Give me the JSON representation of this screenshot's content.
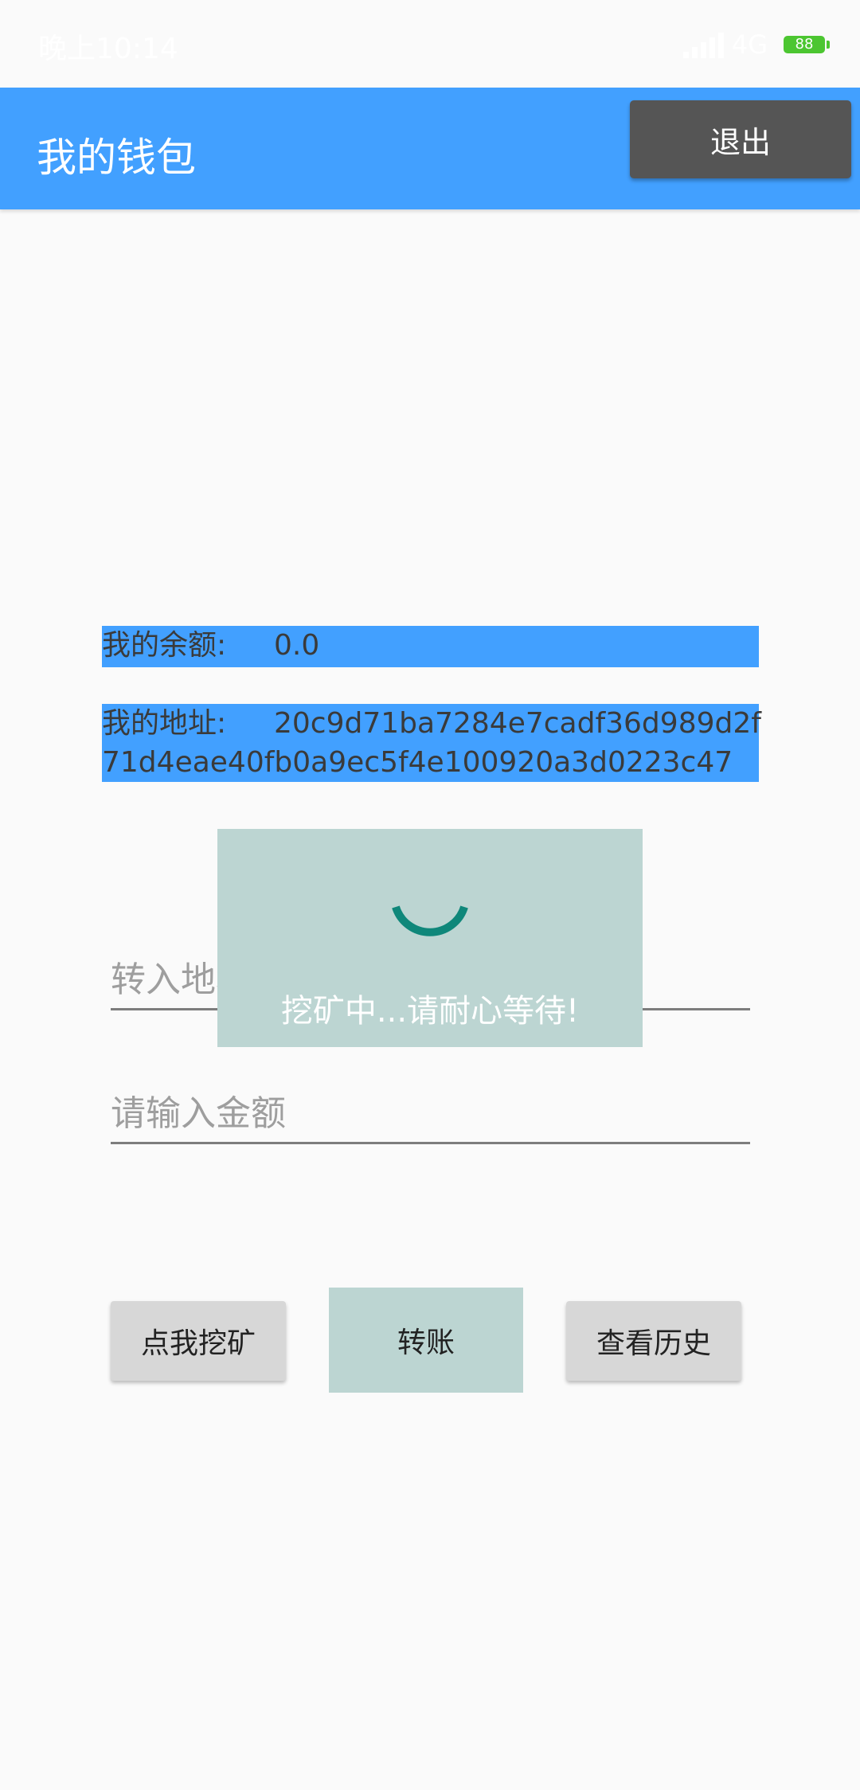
{
  "status_bar": {
    "time": "晚上10:14",
    "network": "4G",
    "battery": "88",
    "icons": [
      "signal-icon",
      "battery-icon"
    ]
  },
  "app_bar": {
    "title": "我的钱包",
    "logout_label": "退出"
  },
  "wallet": {
    "balance_label": "我的余额:",
    "balance_value": "0.0",
    "address_label": "我的地址:",
    "address_line1": "20c9d71ba7284e7cadf36d989d2f",
    "address_line2": "71d4eae40fb0a9ec5f4e100920a3d0223c47"
  },
  "form": {
    "address_placeholder": "转入地址",
    "amount_placeholder": "请输入金额"
  },
  "actions": {
    "mine_label": "点我挖矿",
    "transfer_label": "转账",
    "history_label": "查看历史"
  },
  "dialog": {
    "message": "挖矿中...请耐心等待!",
    "icon": "spinner-icon"
  },
  "colors": {
    "accent": "#42a0ff",
    "dialog_bg": "#bcd5d2",
    "spinner": "#0f877a",
    "logout_bg": "#555555"
  }
}
